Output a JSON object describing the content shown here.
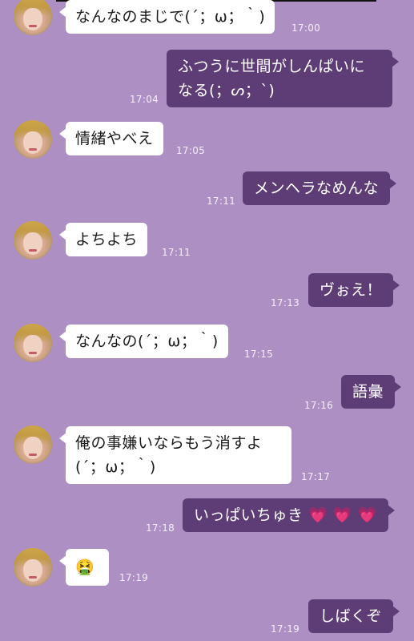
{
  "chat": {
    "messages": [
      {
        "side": "in",
        "text": "なんなのまじで(´；ω；｀)",
        "time": "17:00"
      },
      {
        "side": "out",
        "line1": "ふつうに世間がしんぱいに",
        "line2": "なる(；ᔕ；`)",
        "time": "17:04"
      },
      {
        "side": "in",
        "text": "情緒やべえ",
        "time": "17:05"
      },
      {
        "side": "out",
        "text": "メンヘラなめんな",
        "time": "17:11"
      },
      {
        "side": "in",
        "text": "よちよち",
        "time": "17:11"
      },
      {
        "side": "out",
        "text": "ヴぉえ！",
        "time": "17:13"
      },
      {
        "side": "in",
        "text": "なんなの(´；ω；｀)",
        "time": "17:15"
      },
      {
        "side": "out",
        "text": "語彙",
        "time": "17:16"
      },
      {
        "side": "in",
        "line1": "俺の事嫌いならもう消すよ",
        "line2": "(´；ω；｀)",
        "time": "17:17"
      },
      {
        "side": "out",
        "text": "いっぱいちゅき",
        "hearts": "💗 💗 💗",
        "time": "17:18"
      },
      {
        "side": "in",
        "text": "🤮",
        "time": "17:19"
      },
      {
        "side": "out",
        "text": "しばくぞ",
        "time": "17:19"
      }
    ]
  }
}
